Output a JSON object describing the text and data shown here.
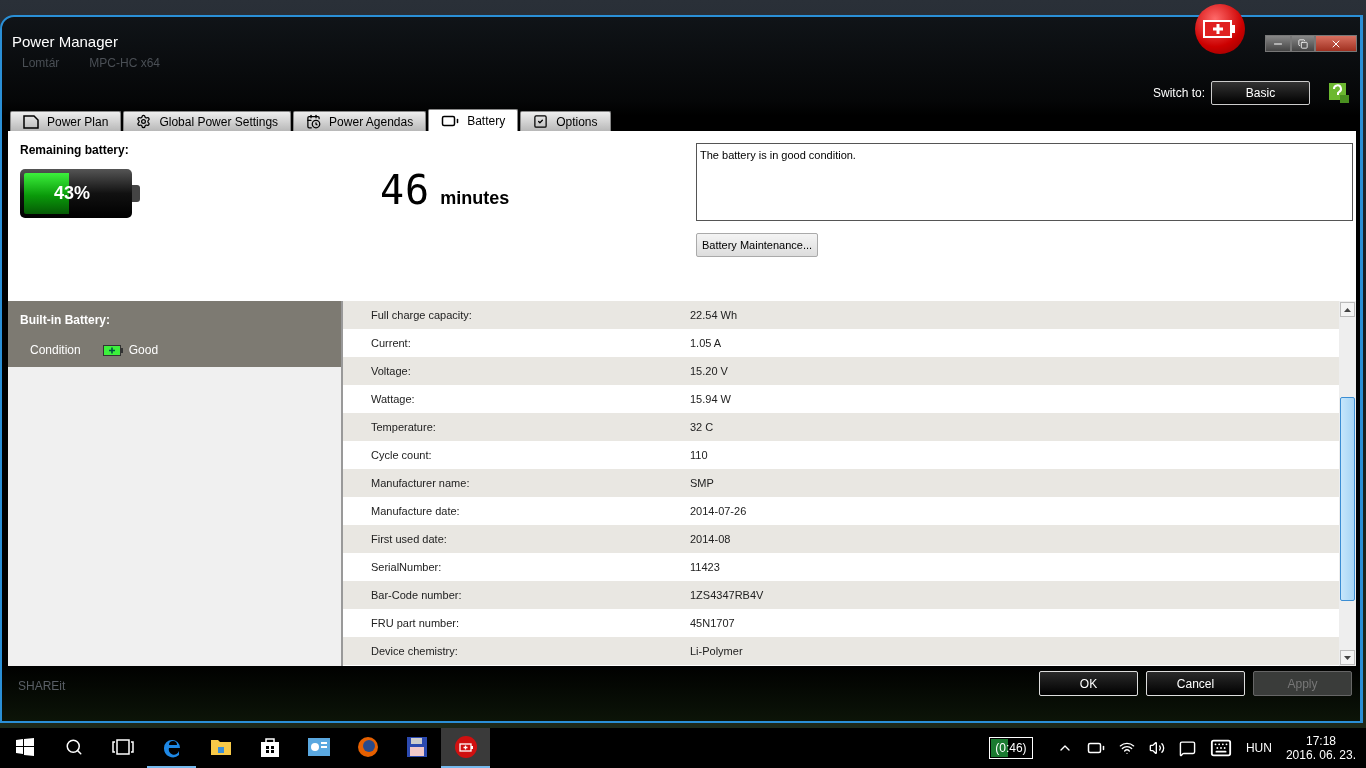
{
  "desktop": {
    "icons": [
      {
        "label": "Lomtár"
      },
      {
        "label": "MPC-HC x64"
      },
      {
        "label": "SHAREit"
      }
    ]
  },
  "window": {
    "title": "Power Manager"
  },
  "switch_to": {
    "label": "Switch to:",
    "button": "Basic"
  },
  "tabs": [
    {
      "label": "Power Plan",
      "selected": false
    },
    {
      "label": "Global Power Settings",
      "selected": false
    },
    {
      "label": "Power Agendas",
      "selected": false
    },
    {
      "label": "Battery",
      "selected": true
    },
    {
      "label": "Options",
      "selected": false
    }
  ],
  "summary": {
    "heading": "Remaining battery:",
    "percent": "43%",
    "level": 0.43,
    "time_value": "46",
    "time_unit": "minutes",
    "message": "The battery is in good condition.",
    "maintenance_button": "Battery Maintenance..."
  },
  "battery_list": {
    "heading": "Built-in Battery:",
    "items": [
      {
        "label": "Condition",
        "status": "Good",
        "selected": true
      }
    ]
  },
  "details": [
    {
      "label": "Full charge capacity:",
      "value": "22.54 Wh"
    },
    {
      "label": "Current:",
      "value": "1.05 A"
    },
    {
      "label": "Voltage:",
      "value": "15.20 V"
    },
    {
      "label": "Wattage:",
      "value": "15.94 W"
    },
    {
      "label": "Temperature:",
      "value": "32 C"
    },
    {
      "label": "Cycle count:",
      "value": "110"
    },
    {
      "label": "Manufacturer name:",
      "value": "SMP"
    },
    {
      "label": "Manufacture date:",
      "value": "2014-07-26"
    },
    {
      "label": "First used date:",
      "value": "2014-08"
    },
    {
      "label": "SerialNumber:",
      "value": "11423"
    },
    {
      "label": "Bar-Code number:",
      "value": "1ZS4347RB4V"
    },
    {
      "label": "FRU part number:",
      "value": "45N1707"
    },
    {
      "label": "Device chemistry:",
      "value": "Li-Polymer"
    }
  ],
  "buttons": [
    {
      "label": "OK",
      "disabled": false
    },
    {
      "label": "Cancel",
      "disabled": false
    },
    {
      "label": "Apply",
      "disabled": true
    }
  ],
  "taskbar": {
    "apps": [
      {
        "kind": "edge",
        "open": true,
        "selected": false
      },
      {
        "kind": "folder",
        "open": false,
        "selected": false
      },
      {
        "kind": "store",
        "open": false,
        "selected": false
      },
      {
        "kind": "panel",
        "open": false,
        "selected": false
      },
      {
        "kind": "firefox",
        "open": false,
        "selected": false
      },
      {
        "kind": "floppy",
        "open": false,
        "selected": false
      },
      {
        "kind": "power",
        "open": true,
        "selected": true
      }
    ],
    "battery_indicator": {
      "text": "(0:46)",
      "level": 0.4
    },
    "language": "HUN",
    "time": "17:18",
    "date": "2016. 06. 23."
  }
}
